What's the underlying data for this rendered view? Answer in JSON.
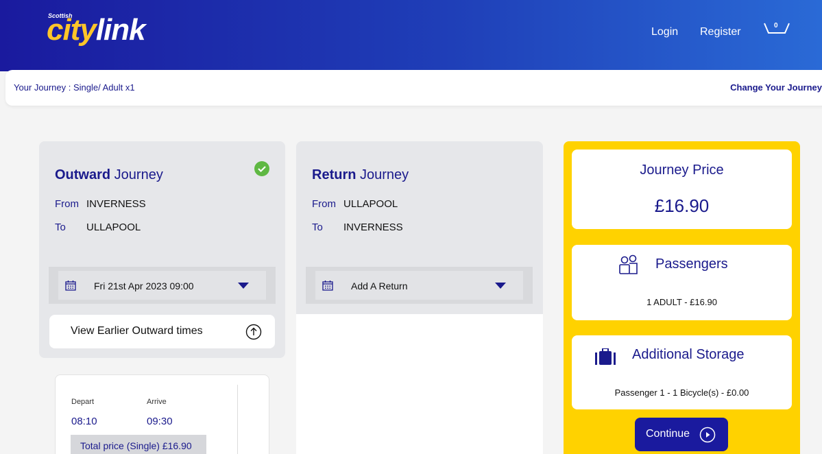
{
  "header": {
    "logo_prefix": "Scottish",
    "logo_city": "city",
    "logo_link": "link",
    "login_label": "Login",
    "register_label": "Register",
    "basket_count": "0"
  },
  "journey_bar": {
    "summary": "Your Journey : Single/ Adult x1",
    "change_label": "Change Your Journey"
  },
  "outward": {
    "title_bold": "Outward",
    "title_rest": " Journey",
    "from_label": "From",
    "from_value": "INVERNESS",
    "to_label": "To",
    "to_value": "ULLAPOOL",
    "date_value": "Fri 21st Apr 2023 09:00",
    "earlier_label": "View Earlier Outward times",
    "trip": {
      "depart_label": "Depart",
      "arrive_label": "Arrive",
      "depart_time": "08:10",
      "arrive_time": "09:30",
      "total_price": "Total price (Single) £16.90"
    }
  },
  "return": {
    "title_bold": "Return",
    "title_rest": " Journey",
    "from_label": "From",
    "from_value": "ULLAPOOL",
    "to_label": "To",
    "to_value": "INVERNESS",
    "date_value": "Add A Return"
  },
  "sidebar": {
    "price_heading": "Journey Price",
    "price_value": "£16.90",
    "passengers_heading": "Passengers",
    "passengers_detail": "1 ADULT - £16.90",
    "storage_heading": "Additional Storage",
    "storage_detail": "Passenger 1 - 1 Bicycle(s) - £0.00",
    "continue_label": "Continue"
  },
  "colors": {
    "brand_blue": "#1a1a8c",
    "brand_yellow": "#ffd200",
    "success_green": "#5fb843"
  },
  "icons": {
    "check": "check-circle-icon",
    "calendar": "calendar-icon",
    "caret": "caret-down-icon",
    "arrow_up": "arrow-up-circle-icon",
    "passengers": "passengers-icon",
    "luggage": "luggage-icon",
    "play": "play-circle-icon",
    "basket": "basket-icon"
  }
}
